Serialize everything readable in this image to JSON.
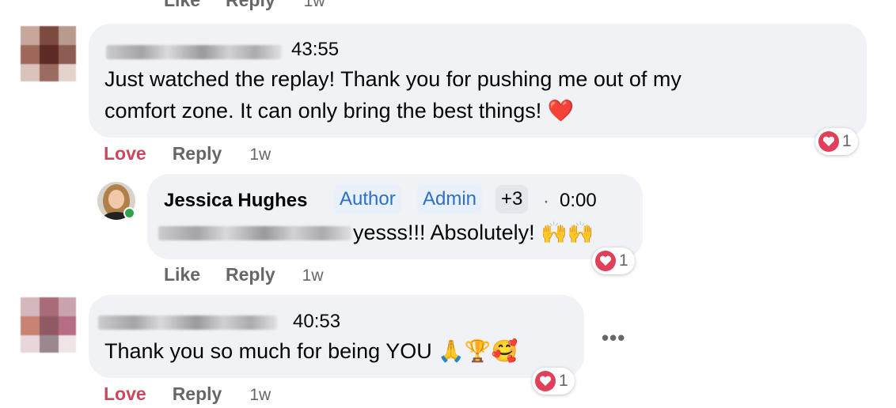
{
  "top_partial": {
    "like": "Like",
    "reply": "Reply",
    "time": "1w"
  },
  "comments": [
    {
      "timestamp": "43:55",
      "text_line1": "Just watched the replay! Thank you for pushing me out of my",
      "text_line2": "comfort zone. It can only bring the best things! ❤️",
      "reaction_count": "1",
      "actions": {
        "love": "Love",
        "reply": "Reply",
        "time": "1w"
      }
    },
    {
      "author": "Jessica Hughes",
      "tags": [
        "Author",
        "Admin",
        "+3"
      ],
      "separator": "·",
      "timestamp": "0:00",
      "text": "yesss!!! Absolutely! 🙌🙌",
      "reaction_count": "1",
      "actions": {
        "like": "Like",
        "reply": "Reply",
        "time": "1w"
      }
    },
    {
      "timestamp": "40:53",
      "text": "Thank you so much for being YOU 🙏🏆🥰",
      "reaction_count": "1",
      "more_label": "•••",
      "actions": {
        "love": "Love",
        "reply": "Reply",
        "time": "1w"
      }
    }
  ],
  "colors": {
    "bubble": "#f0f2f5",
    "love": "#c9485b",
    "tag_text": "#2d6fc4",
    "heart": "#e0405a"
  }
}
